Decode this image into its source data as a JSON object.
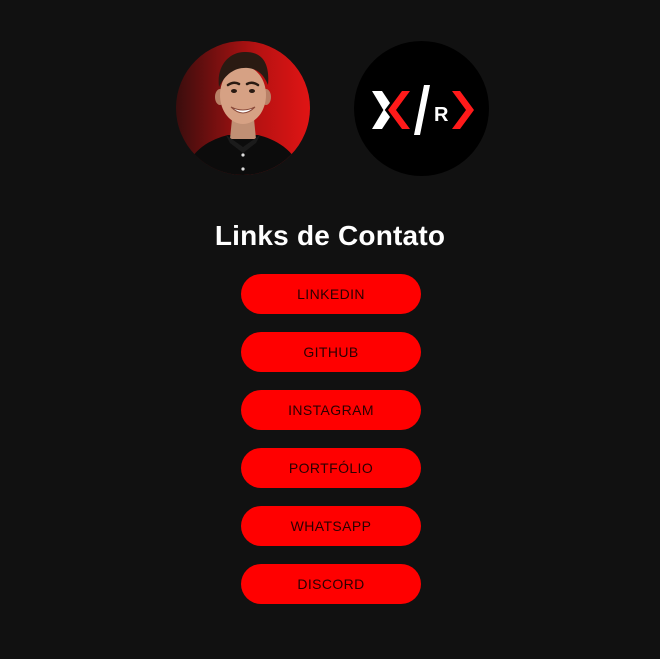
{
  "header": {
    "title": "Links de Contato"
  },
  "avatars": {
    "photo_icon": "profile-photo",
    "logo_icon": "brand-logo",
    "logo_letter": "R"
  },
  "links": [
    {
      "label": "LINKEDIN"
    },
    {
      "label": "GITHUB"
    },
    {
      "label": "INSTAGRAM"
    },
    {
      "label": "PORTFÓLIO"
    },
    {
      "label": "WHATSAPP"
    },
    {
      "label": "DISCORD"
    }
  ],
  "colors": {
    "background": "#111111",
    "accent": "#ff0000",
    "button_text": "#2a0000",
    "title_text": "#ffffff"
  }
}
